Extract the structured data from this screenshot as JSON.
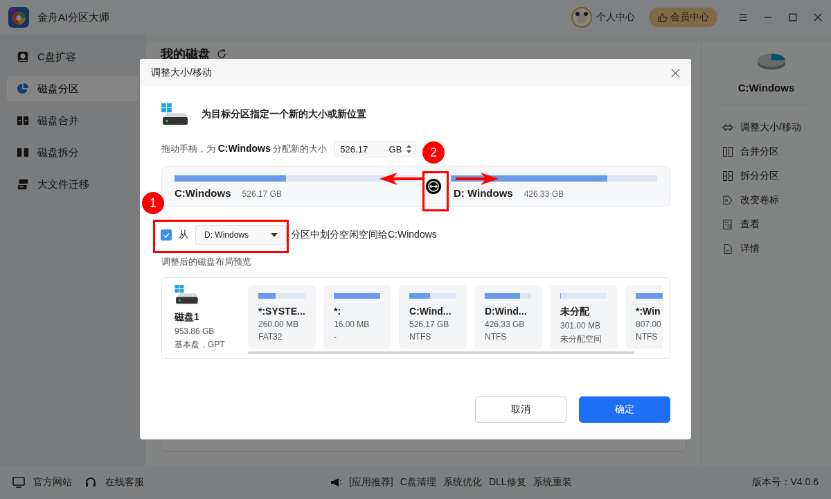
{
  "app": {
    "title": "金舟AI分区大师",
    "user_center": "个人中心",
    "vip_center": "会员中心"
  },
  "sidebar": {
    "items": [
      {
        "label": "C盘扩容",
        "selected": false
      },
      {
        "label": "磁盘分区",
        "selected": true
      },
      {
        "label": "磁盘合并",
        "selected": false
      },
      {
        "label": "磁盘拆分",
        "selected": false
      },
      {
        "label": "大文件迁移",
        "selected": false
      }
    ]
  },
  "main": {
    "heading": "我的磁盘"
  },
  "right_panel": {
    "partition": "C:Windows",
    "actions": [
      "调整大小/移动",
      "合并分区",
      "拆分分区",
      "改变卷标",
      "查看",
      "详情"
    ]
  },
  "footer": {
    "links": [
      "官方网站",
      "在线客服"
    ],
    "promo_label": "[应用推荐]",
    "promo_items": [
      "C盘清理",
      "系统优化",
      "DLL修复",
      "系统重装"
    ],
    "version": "版本号：V4.0.6"
  },
  "dialog": {
    "title": "调整大小/移动",
    "heading": "为目标分区指定一个新的大小或新位置",
    "size_prompt": "拖动手柄，为 **C:Windows** 分配新的大小",
    "size_value": "526.17",
    "size_unit": "GB",
    "resize": [
      {
        "name": "C:Windows",
        "size": "526.17 GB",
        "level": 0.46
      },
      {
        "name": "D: Windows",
        "size": "426.33 GB",
        "level": 0.76
      }
    ],
    "allocate": {
      "checked": true,
      "prefix": "从",
      "source": "D: Windows",
      "suffix": "分区中划分空闲空间给C:Windows"
    },
    "preview_label": "调整后的磁盘布局预览",
    "disk": {
      "name": "磁盘1",
      "size": "953.86 GB",
      "type": "基本盘，GPT"
    },
    "partitions": [
      {
        "name": "*:SYSTE...",
        "size": "260.00 MB",
        "fs": "FAT32",
        "level": 0.37
      },
      {
        "name": "*:",
        "size": "16.00 MB",
        "fs": "-",
        "level": 1
      },
      {
        "name": "C:Wind...",
        "size": "526.17 GB",
        "fs": "NTFS",
        "level": 0.45
      },
      {
        "name": "D:Wind...",
        "size": "426.33 GB",
        "fs": "NTFS",
        "level": 0.76
      },
      {
        "name": "未分配",
        "size": "301.00 MB",
        "fs": "未分配空间",
        "level": 0
      },
      {
        "name": "*:Win",
        "size": "807.00",
        "fs": "NTFS",
        "level": 1
      }
    ],
    "buttons": [
      {
        "label": "取消",
        "kind": "secondary"
      },
      {
        "label": "确定",
        "kind": "primary"
      }
    ]
  },
  "annotations": [
    {
      "label": "1"
    },
    {
      "label": "2"
    }
  ]
}
